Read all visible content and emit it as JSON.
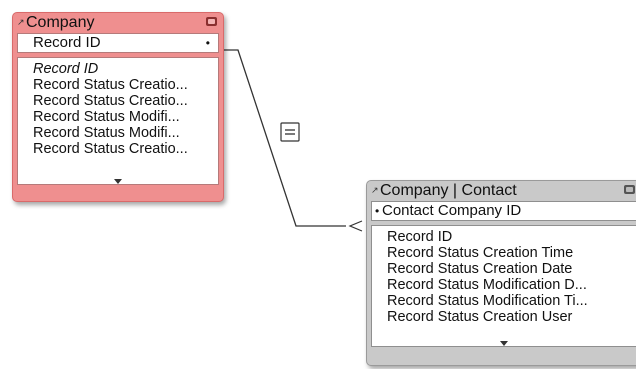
{
  "relationship": {
    "operator_icon": "equals-icon"
  },
  "company_table": {
    "name": "Company",
    "match_field": "Record ID",
    "fields": [
      "Record ID",
      "Record Status Creatio...",
      "Record Status Creatio...",
      "Record Status Modifi...",
      "Record Status Modifi...",
      "Record Status Creatio..."
    ],
    "color": "#ef8f8f"
  },
  "contact_table": {
    "name": "Company | Contact",
    "match_field": "Contact Company ID",
    "fields": [
      "Record ID",
      "Record Status Creation Time",
      "Record Status Creation Date",
      "Record Status Modification D...",
      "Record Status Modification Ti...",
      "Record Status Creation User"
    ],
    "color": "#c9c9c9"
  }
}
